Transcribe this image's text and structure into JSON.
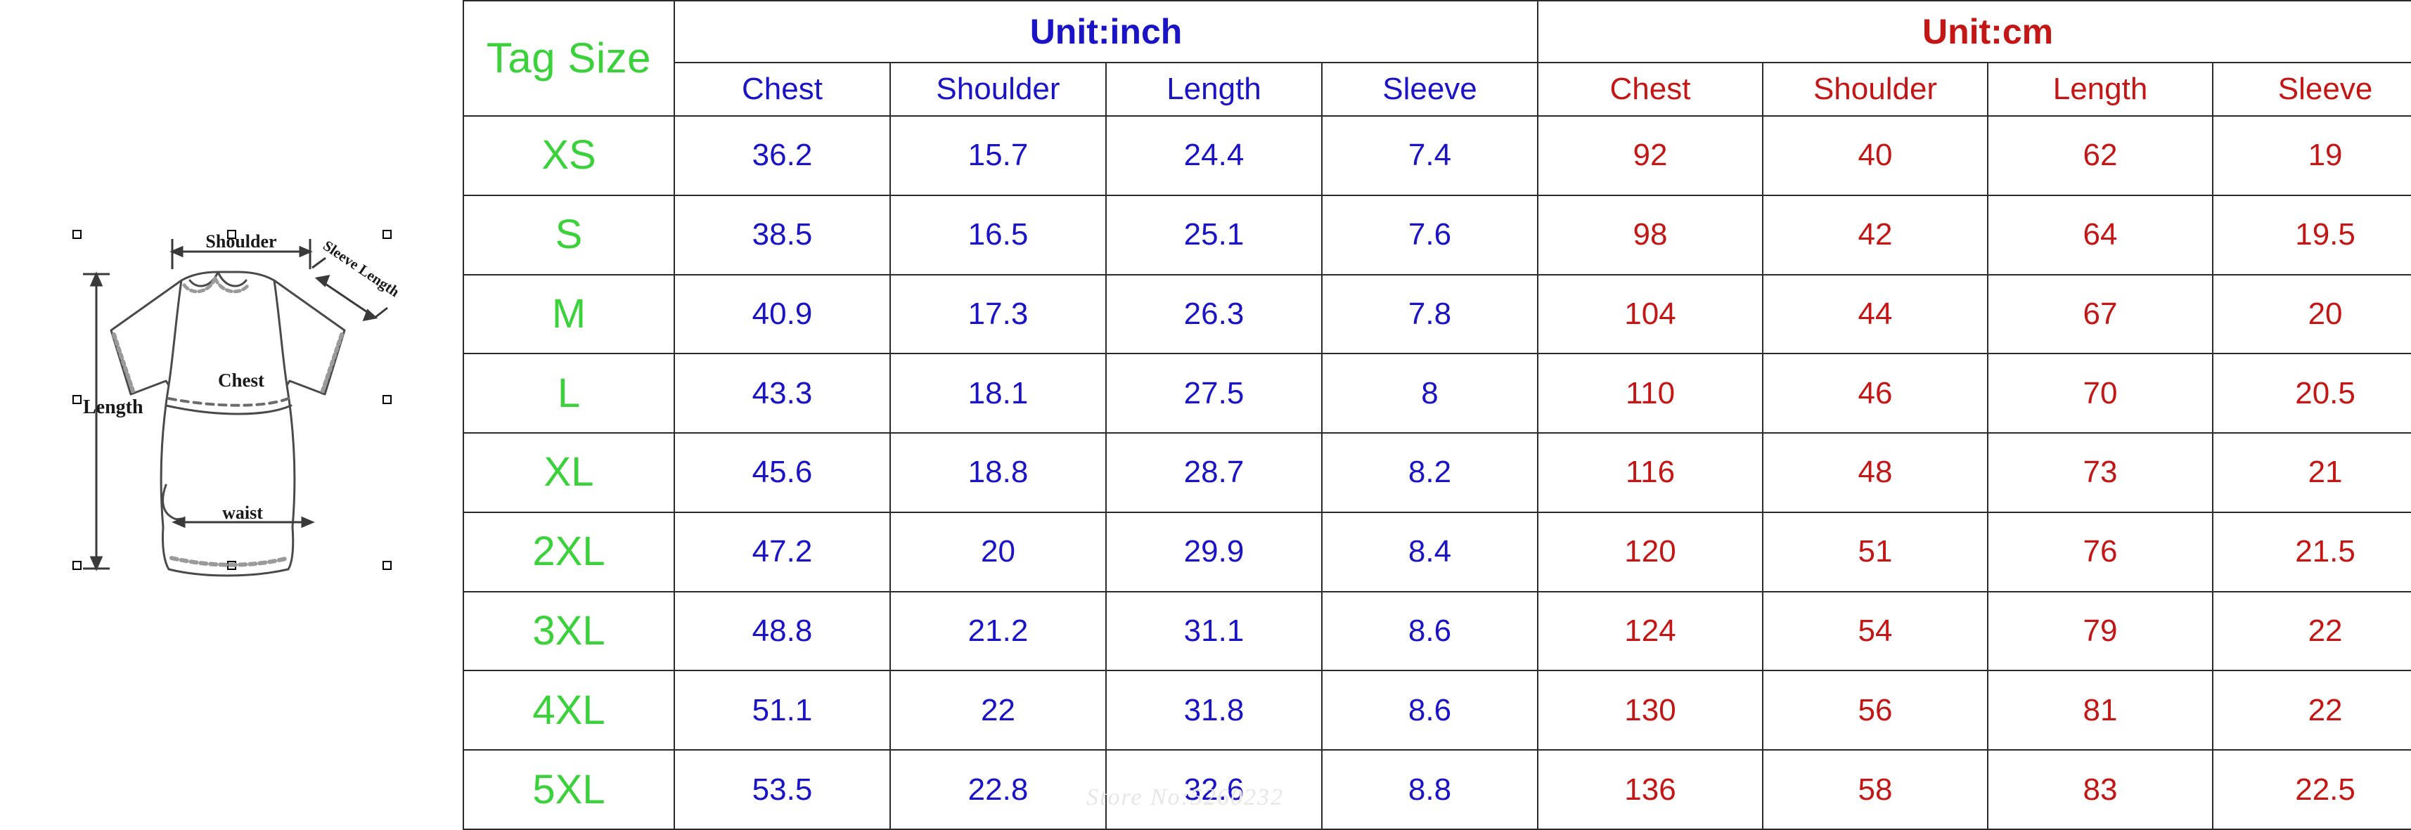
{
  "diagram": {
    "alt_name": "t-shirt-measurement-diagram",
    "labels": {
      "shoulder": "Shoulder",
      "sleeve_length": "Sleeve Length",
      "chest": "Chest",
      "length": "Length",
      "waist": "waist"
    }
  },
  "table": {
    "tag_size_header": "Tag Size",
    "unit_inch_header": "Unit:inch",
    "unit_cm_header": "Unit:cm",
    "columns_inch": [
      "Chest",
      "Shoulder",
      "Length",
      "Sleeve"
    ],
    "columns_cm": [
      "Chest",
      "Shoulder",
      "Length",
      "Sleeve"
    ],
    "rows": [
      {
        "size": "XS",
        "inch": [
          "36.2",
          "15.7",
          "24.4",
          "7.4"
        ],
        "cm": [
          "92",
          "40",
          "62",
          "19"
        ]
      },
      {
        "size": "S",
        "inch": [
          "38.5",
          "16.5",
          "25.1",
          "7.6"
        ],
        "cm": [
          "98",
          "42",
          "64",
          "19.5"
        ]
      },
      {
        "size": "M",
        "inch": [
          "40.9",
          "17.3",
          "26.3",
          "7.8"
        ],
        "cm": [
          "104",
          "44",
          "67",
          "20"
        ]
      },
      {
        "size": "L",
        "inch": [
          "43.3",
          "18.1",
          "27.5",
          "8"
        ],
        "cm": [
          "110",
          "46",
          "70",
          "20.5"
        ]
      },
      {
        "size": "XL",
        "inch": [
          "45.6",
          "18.8",
          "28.7",
          "8.2"
        ],
        "cm": [
          "116",
          "48",
          "73",
          "21"
        ]
      },
      {
        "size": "2XL",
        "inch": [
          "47.2",
          "20",
          "29.9",
          "8.4"
        ],
        "cm": [
          "120",
          "51",
          "76",
          "21.5"
        ]
      },
      {
        "size": "3XL",
        "inch": [
          "48.8",
          "21.2",
          "31.1",
          "8.6"
        ],
        "cm": [
          "124",
          "54",
          "79",
          "22"
        ]
      },
      {
        "size": "4XL",
        "inch": [
          "51.1",
          "22",
          "31.8",
          "8.6"
        ],
        "cm": [
          "130",
          "56",
          "81",
          "22"
        ]
      },
      {
        "size": "5XL",
        "inch": [
          "53.5",
          "22.8",
          "32.6",
          "8.8"
        ],
        "cm": [
          "136",
          "58",
          "83",
          "22.5"
        ]
      }
    ]
  },
  "watermark": {
    "text": "Store No:5260232"
  },
  "colors": {
    "tag_size_green": "#3ad13a",
    "inch_blue": "#1a14c6",
    "cm_red": "#c51616",
    "grid_line": "#2b2b2b",
    "watermark_gray": "#e6e6e6"
  }
}
